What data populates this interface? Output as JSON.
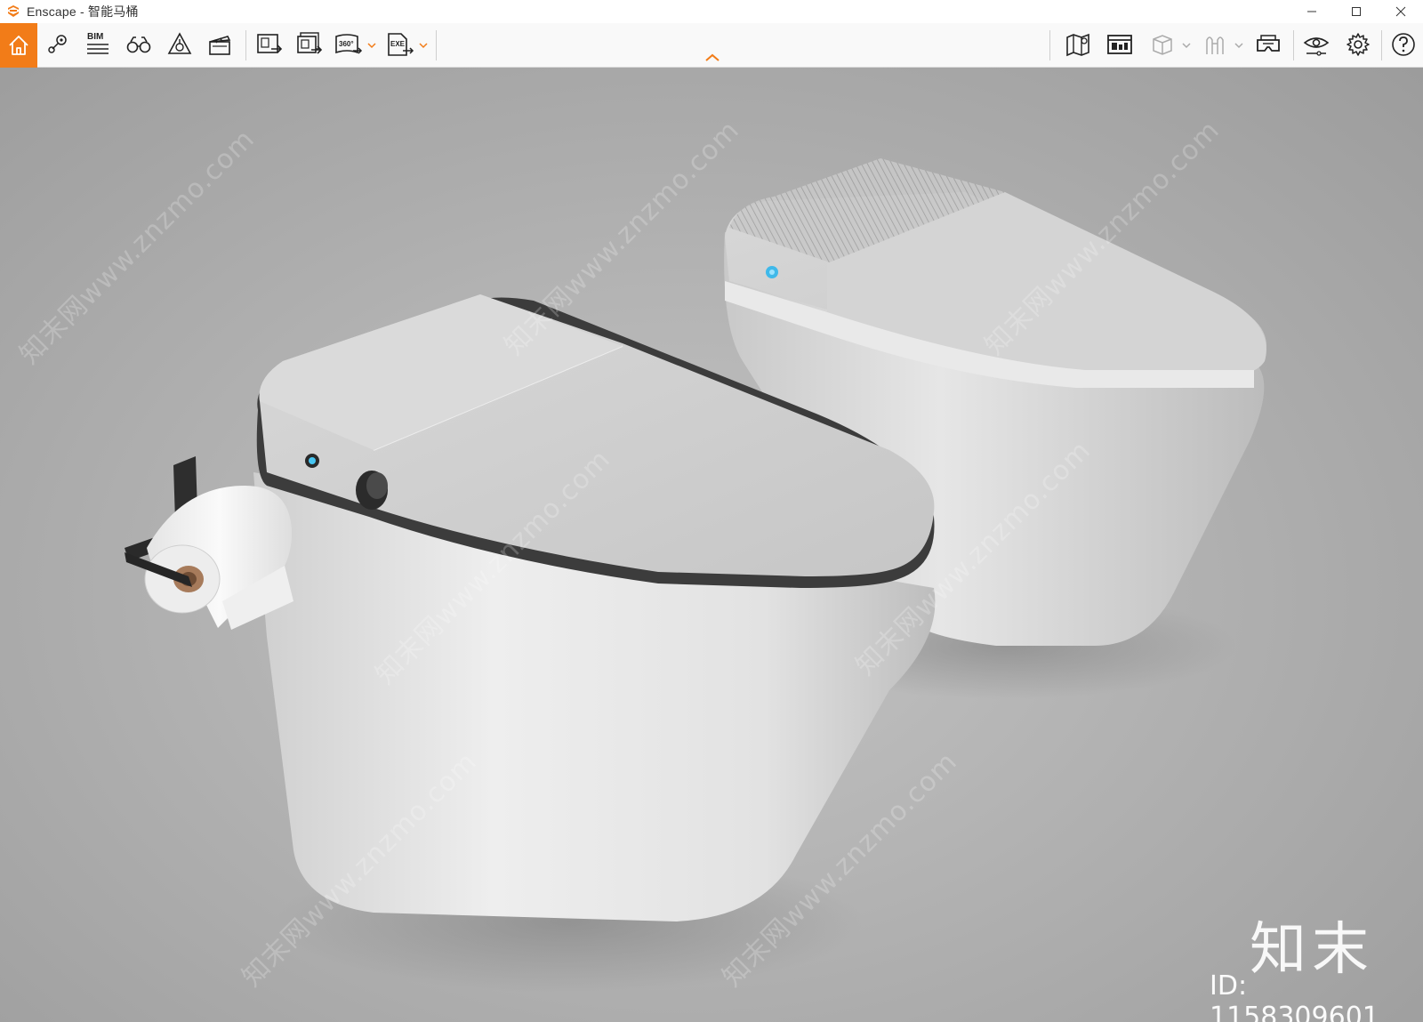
{
  "window": {
    "app_name": "Enscape - 智能马桶",
    "brand_color": "#f27c18"
  },
  "toolbar": {
    "left_buttons": [
      {
        "name": "home-button",
        "icon": "home-icon"
      },
      {
        "name": "views-button",
        "icon": "map-pin-icon"
      },
      {
        "name": "bim-button",
        "icon": "bim-icon",
        "label": "BIM"
      },
      {
        "name": "walk-mode-button",
        "icon": "binoculars-icon"
      },
      {
        "name": "assets-button",
        "icon": "asset-library-icon"
      },
      {
        "name": "video-editor-button",
        "icon": "clapperboard-icon"
      },
      {
        "name": "screenshot-button",
        "icon": "render-image-icon"
      },
      {
        "name": "batch-render-button",
        "icon": "batch-render-icon"
      },
      {
        "name": "panorama-button",
        "icon": "panorama-icon",
        "label": "360°"
      },
      {
        "name": "export-button",
        "icon": "export-icon",
        "label": "EXE"
      }
    ],
    "right_buttons": [
      {
        "name": "map-button",
        "icon": "map-icon"
      },
      {
        "name": "panels-button",
        "icon": "panel-icon"
      },
      {
        "name": "view-cube-button",
        "icon": "cube-icon"
      },
      {
        "name": "material-button",
        "icon": "material-icon"
      },
      {
        "name": "vr-button",
        "icon": "vr-headset-icon"
      },
      {
        "name": "visual-settings-button",
        "icon": "eye-settings-icon"
      },
      {
        "name": "settings-button",
        "icon": "gear-icon"
      },
      {
        "name": "help-button",
        "icon": "help-icon"
      }
    ]
  },
  "watermark": {
    "brand": "知末",
    "id_text": "ID: 1158309601",
    "diagonal_text": "知末网www.znzmo.com"
  }
}
